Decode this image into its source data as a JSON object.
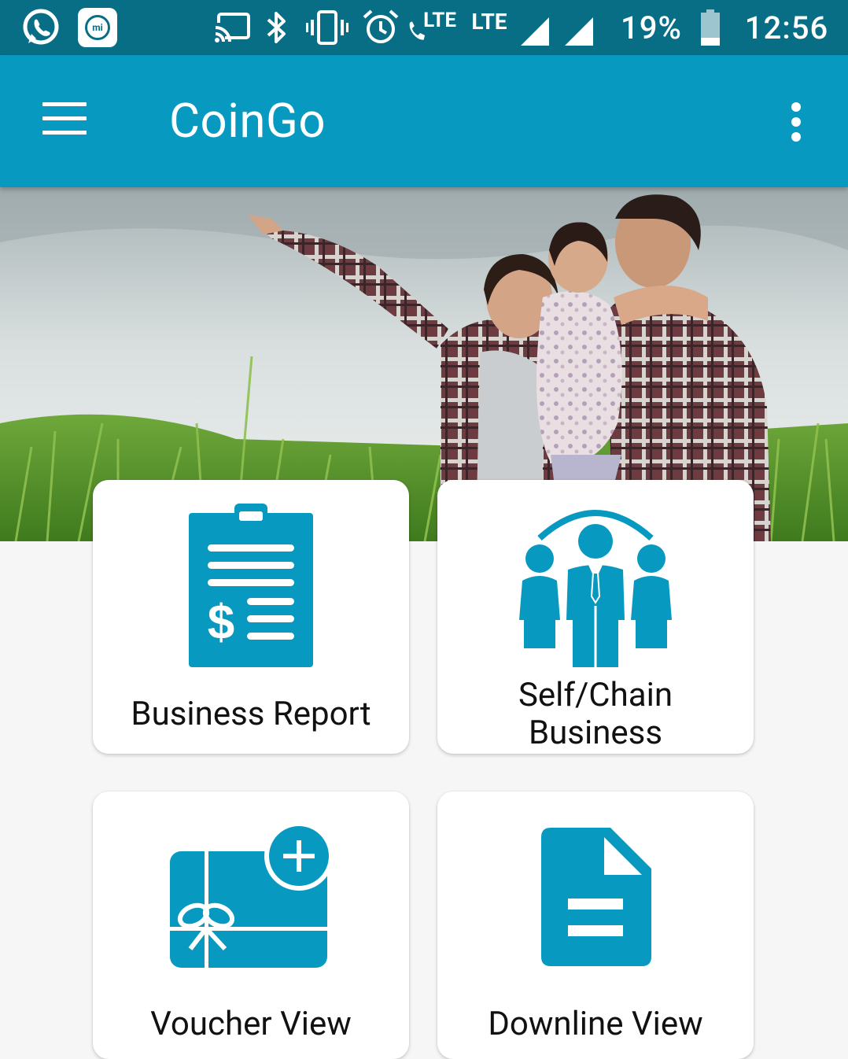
{
  "status_bar": {
    "icons": [
      "whatsapp-icon",
      "mi-icon",
      "cast-icon",
      "bluetooth-icon",
      "vibrate-icon",
      "alarm-icon",
      "volte-call-icon",
      "lte-icon",
      "signal-icon",
      "signal-icon",
      "battery-icon"
    ],
    "call_lte_label": "LTE",
    "lte_label": "LTE",
    "battery": "19%",
    "time": "12:56",
    "mi_label": "mi"
  },
  "app_bar": {
    "title": "CoinGo",
    "menu_icon": "hamburger-menu-icon",
    "overflow_icon": "more-vertical-icon"
  },
  "banner": {
    "image": "family-in-field-photo"
  },
  "tiles": [
    {
      "label": "Business Report",
      "icon": "clipboard-dollar-icon"
    },
    {
      "label_line1": "Self/Chain",
      "label_line2": "Business",
      "icon": "team-network-icon"
    },
    {
      "label": "Voucher View",
      "icon": "gift-card-add-icon"
    },
    {
      "label": "Downline View",
      "icon": "document-icon"
    }
  ],
  "colors": {
    "status_bar": "#086e86",
    "app_bar": "#0799bf",
    "icon_accent": "#0799bf",
    "background": "#f6f6f6"
  }
}
